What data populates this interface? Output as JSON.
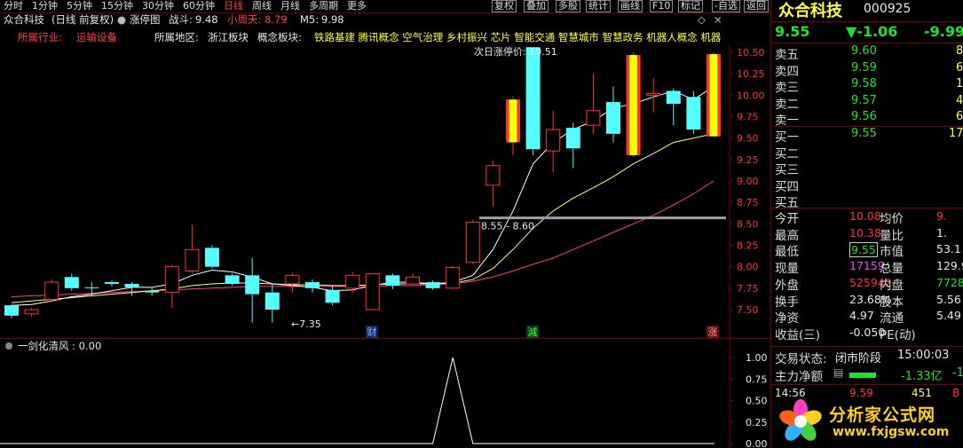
{
  "menu": {
    "items": [
      "分时",
      "1分钟",
      "5分钟",
      "15分钟",
      "30分钟",
      "60分钟",
      "日线",
      "周线",
      "月线",
      "多周期",
      "更多"
    ],
    "active": "日线",
    "buttons": [
      "复权",
      "叠加",
      "多股",
      "统计",
      "画线",
      "F10",
      "标记",
      "-自选",
      "返回"
    ]
  },
  "info": {
    "stock_name": "众合科技",
    "mode": "(日线 前复权)",
    "indicator_name": "涨停图",
    "zhandou_label": "战斗:",
    "zhandou_value": "9.48",
    "xiaozhoutian_label": "小周天:",
    "xiaozhoutian_value": "8.79",
    "m5_label": "M5:",
    "m5_value": "9.98",
    "diamond": "◇",
    "close_x": "×"
  },
  "industry": {
    "industry_label": "所属行业:",
    "industry_value": "运输设备",
    "region_label": "所属地区:",
    "region_value": "浙江板块",
    "concept_label": "概念板块:",
    "concept_value": "铁路基建 腾讯概念 空气治理 乡村振兴 芯片 智能交通 智慧城市 智慧政务 机器人概念 机器"
  },
  "chart": {
    "next_limit_label": "次日涨停价:",
    "next_limit_value": "10.51",
    "support_label": "8.55 - 8.60",
    "low_label": "←7.35",
    "marker_cai": "财",
    "marker_jian": "減",
    "marker_zhang": "涨",
    "price_ticks": [
      "10.50",
      "10.25",
      "10.00",
      "9.75",
      "9.50",
      "9.25",
      "9.00",
      "8.75",
      "8.50",
      "8.25",
      "8.00",
      "7.75",
      "7.50"
    ]
  },
  "indicator": {
    "name": "一剑化清风",
    "value_label": ": 0.00",
    "ticks": [
      "1.00",
      "0.75",
      "0.50",
      "0.25",
      "0.00"
    ]
  },
  "chart_data": {
    "type": "candlestick",
    "candles": [
      {
        "o": 7.55,
        "c": 7.43,
        "h": 7.56,
        "l": 7.4,
        "limit": false
      },
      {
        "o": 7.45,
        "c": 7.5,
        "h": 7.52,
        "l": 7.42,
        "limit": false
      },
      {
        "o": 7.62,
        "c": 7.82,
        "h": 7.85,
        "l": 7.6,
        "limit": false
      },
      {
        "o": 7.88,
        "c": 7.75,
        "h": 7.92,
        "l": 7.72,
        "limit": false
      },
      {
        "o": 7.76,
        "c": 7.75,
        "h": 7.82,
        "l": 7.66,
        "limit": false
      },
      {
        "o": 7.82,
        "c": 7.8,
        "h": 7.84,
        "l": 7.77,
        "limit": false
      },
      {
        "o": 7.8,
        "c": 7.76,
        "h": 7.82,
        "l": 7.66,
        "limit": false
      },
      {
        "o": 7.72,
        "c": 7.7,
        "h": 7.76,
        "l": 7.66,
        "limit": false
      },
      {
        "o": 7.7,
        "c": 8.0,
        "h": 8.02,
        "l": 7.52,
        "limit": false
      },
      {
        "o": 7.95,
        "c": 8.2,
        "h": 8.49,
        "l": 7.92,
        "limit": false
      },
      {
        "o": 8.22,
        "c": 8.0,
        "h": 8.25,
        "l": 7.98,
        "limit": false
      },
      {
        "o": 7.9,
        "c": 7.8,
        "h": 7.92,
        "l": 7.78,
        "limit": false
      },
      {
        "o": 7.9,
        "c": 7.68,
        "h": 8.1,
        "l": 7.35,
        "limit": false
      },
      {
        "o": 7.7,
        "c": 7.5,
        "h": 7.8,
        "l": 7.35,
        "limit": false
      },
      {
        "o": 7.8,
        "c": 7.9,
        "h": 7.93,
        "l": 7.7,
        "limit": false
      },
      {
        "o": 7.82,
        "c": 7.75,
        "h": 7.85,
        "l": 7.7,
        "limit": false
      },
      {
        "o": 7.73,
        "c": 7.58,
        "h": 7.77,
        "l": 7.55,
        "limit": false
      },
      {
        "o": 7.75,
        "c": 7.9,
        "h": 7.94,
        "l": 7.7,
        "limit": false
      },
      {
        "o": 7.5,
        "c": 7.92,
        "h": 7.93,
        "l": 7.5,
        "limit": false
      },
      {
        "o": 7.9,
        "c": 7.78,
        "h": 7.92,
        "l": 7.74,
        "limit": false
      },
      {
        "o": 7.8,
        "c": 7.88,
        "h": 7.92,
        "l": 7.78,
        "limit": false
      },
      {
        "o": 7.82,
        "c": 7.75,
        "h": 7.84,
        "l": 7.73,
        "limit": false
      },
      {
        "o": 7.75,
        "c": 7.99,
        "h": 8.01,
        "l": 7.74,
        "limit": false
      },
      {
        "o": 8.05,
        "c": 8.52,
        "h": 8.55,
        "l": 8.03,
        "limit": false
      },
      {
        "o": 8.95,
        "c": 9.18,
        "h": 9.24,
        "l": 8.7,
        "limit": false
      },
      {
        "o": 9.45,
        "c": 9.95,
        "h": 9.99,
        "l": 9.3,
        "limit": true
      },
      {
        "o": 10.56,
        "c": 9.37,
        "h": 10.56,
        "l": 9.3,
        "limit": false
      },
      {
        "o": 9.35,
        "c": 9.6,
        "h": 9.82,
        "l": 9.1,
        "limit": false
      },
      {
        "o": 9.62,
        "c": 9.38,
        "h": 9.68,
        "l": 9.15,
        "limit": false
      },
      {
        "o": 9.65,
        "c": 9.82,
        "h": 10.25,
        "l": 9.55,
        "limit": false
      },
      {
        "o": 9.92,
        "c": 9.55,
        "h": 10.1,
        "l": 9.45,
        "limit": false
      },
      {
        "o": 9.3,
        "c": 10.47,
        "h": 10.5,
        "l": 9.28,
        "limit": true
      },
      {
        "o": 10.0,
        "c": 10.02,
        "h": 10.2,
        "l": 9.8,
        "limit": false
      },
      {
        "o": 10.05,
        "c": 9.9,
        "h": 10.08,
        "l": 9.65,
        "limit": false
      },
      {
        "o": 9.98,
        "c": 9.6,
        "h": 10.05,
        "l": 9.55,
        "limit": false
      },
      {
        "o": 9.52,
        "c": 10.48,
        "h": 10.5,
        "l": 9.52,
        "limit": true
      }
    ],
    "ma_short": [
      7.55,
      7.56,
      7.6,
      7.65,
      7.68,
      7.72,
      7.76,
      7.76,
      7.8,
      7.9,
      7.96,
      7.94,
      7.88,
      7.8,
      7.78,
      7.76,
      7.72,
      7.73,
      7.78,
      7.82,
      7.82,
      7.8,
      7.82,
      7.9,
      8.2,
      8.65,
      9.2,
      9.45,
      9.6,
      9.7,
      9.85,
      9.9,
      9.98,
      10.05,
      9.95,
      10.1
    ],
    "ma_mid": [
      7.58,
      7.6,
      7.62,
      7.64,
      7.66,
      7.68,
      7.7,
      7.72,
      7.74,
      7.78,
      7.8,
      7.81,
      7.81,
      7.8,
      7.79,
      7.79,
      7.78,
      7.78,
      7.79,
      7.8,
      7.8,
      7.8,
      7.81,
      7.85,
      7.98,
      8.2,
      8.45,
      8.65,
      8.8,
      8.92,
      9.05,
      9.2,
      9.32,
      9.45,
      9.5,
      9.55
    ],
    "ma_long": [
      7.65,
      7.66,
      7.67,
      7.68,
      7.69,
      7.7,
      7.71,
      7.72,
      7.73,
      7.74,
      7.75,
      7.76,
      7.77,
      7.77,
      7.77,
      7.77,
      7.77,
      7.77,
      7.77,
      7.78,
      7.78,
      7.79,
      7.8,
      7.83,
      7.88,
      7.95,
      8.03,
      8.1,
      8.2,
      8.3,
      8.4,
      8.5,
      8.6,
      8.72,
      8.85,
      9.0
    ],
    "support_level": 8.57,
    "indicator_values": [
      0,
      0,
      0,
      0,
      0,
      0,
      0,
      0,
      0,
      0,
      0,
      0,
      0,
      0,
      0,
      0,
      0,
      0,
      0,
      0,
      0,
      0,
      1,
      0,
      0,
      0,
      0,
      0,
      0,
      0,
      0,
      0,
      0,
      0,
      0,
      0
    ],
    "ylim": [
      7.35,
      10.55
    ],
    "indicator_ylim": [
      0,
      1
    ]
  },
  "quote": {
    "name": "众合科技",
    "code": "000925",
    "price": "9.55",
    "change": "▼-1.06",
    "pct": "-9.99",
    "sells": [
      {
        "label": "卖五",
        "price": "9.60",
        "vol": "8"
      },
      {
        "label": "卖四",
        "price": "9.59",
        "vol": "6"
      },
      {
        "label": "卖三",
        "price": "9.58",
        "vol": "1"
      },
      {
        "label": "卖二",
        "price": "9.57",
        "vol": "4"
      },
      {
        "label": "卖一",
        "price": "9.56",
        "vol": "6"
      }
    ],
    "buys": [
      {
        "label": "买一",
        "price": "9.55",
        "vol": "170"
      },
      {
        "label": "买二",
        "price": "",
        "vol": ""
      },
      {
        "label": "买三",
        "price": "",
        "vol": ""
      },
      {
        "label": "买四",
        "price": "",
        "vol": ""
      },
      {
        "label": "买五",
        "price": "",
        "vol": ""
      }
    ],
    "stats": [
      {
        "l1": "今开",
        "v1": "10.08",
        "c1": "red",
        "l2": "均价",
        "v2": "9.",
        "c2": "red"
      },
      {
        "l1": "最高",
        "v1": "10.38",
        "c1": "red",
        "l2": "量比",
        "v2": "1.",
        "c2": "wht"
      },
      {
        "l1": "最低",
        "v1": "9.55",
        "c1": "grn",
        "l2": "市值",
        "v2": "53.1",
        "c2": "wht"
      },
      {
        "l1": "现量",
        "v1": "17159",
        "c1": "mag",
        "l2": "总量",
        "v2": "129.9",
        "c2": "wht"
      },
      {
        "l1": "外盘",
        "v1": "525942",
        "c1": "red",
        "l2": "内盘",
        "v2": "7728",
        "c2": "grn"
      },
      {
        "l1": "换手",
        "v1": "23.68%",
        "c1": "wht",
        "l2": "股本",
        "v2": "5.56",
        "c2": "wht"
      },
      {
        "l1": "净资",
        "v1": "4.97",
        "c1": "wht",
        "l2": "流通",
        "v2": "5.49",
        "c2": "wht"
      },
      {
        "l1": "收益(三)",
        "v1": "-0.050",
        "c1": "wht",
        "l2": "PE(动)",
        "v2": "",
        "c2": "wht"
      }
    ],
    "trade_status_label": "交易状态:",
    "trade_status_value": "闭市阶段",
    "trade_status_time": "15:00:03",
    "main_flow_label": "主力净额",
    "main_flow_value": "-1.33亿",
    "main_flow_extra": "-1",
    "tick_time": "14:56",
    "tick_price": "9.59",
    "tick_vol": "451",
    "tick_dir": "B"
  },
  "logo": {
    "title": "分析家公式网",
    "url": "www.fxjgsw.com"
  },
  "colors": {
    "up": "#ff3232",
    "down": "#54fcfc",
    "limit": "#ffff00",
    "ma_short": "#ffffff",
    "ma_mid": "#ffff80",
    "ma_long": "#ff3c8c",
    "grid": "#7a0000"
  }
}
